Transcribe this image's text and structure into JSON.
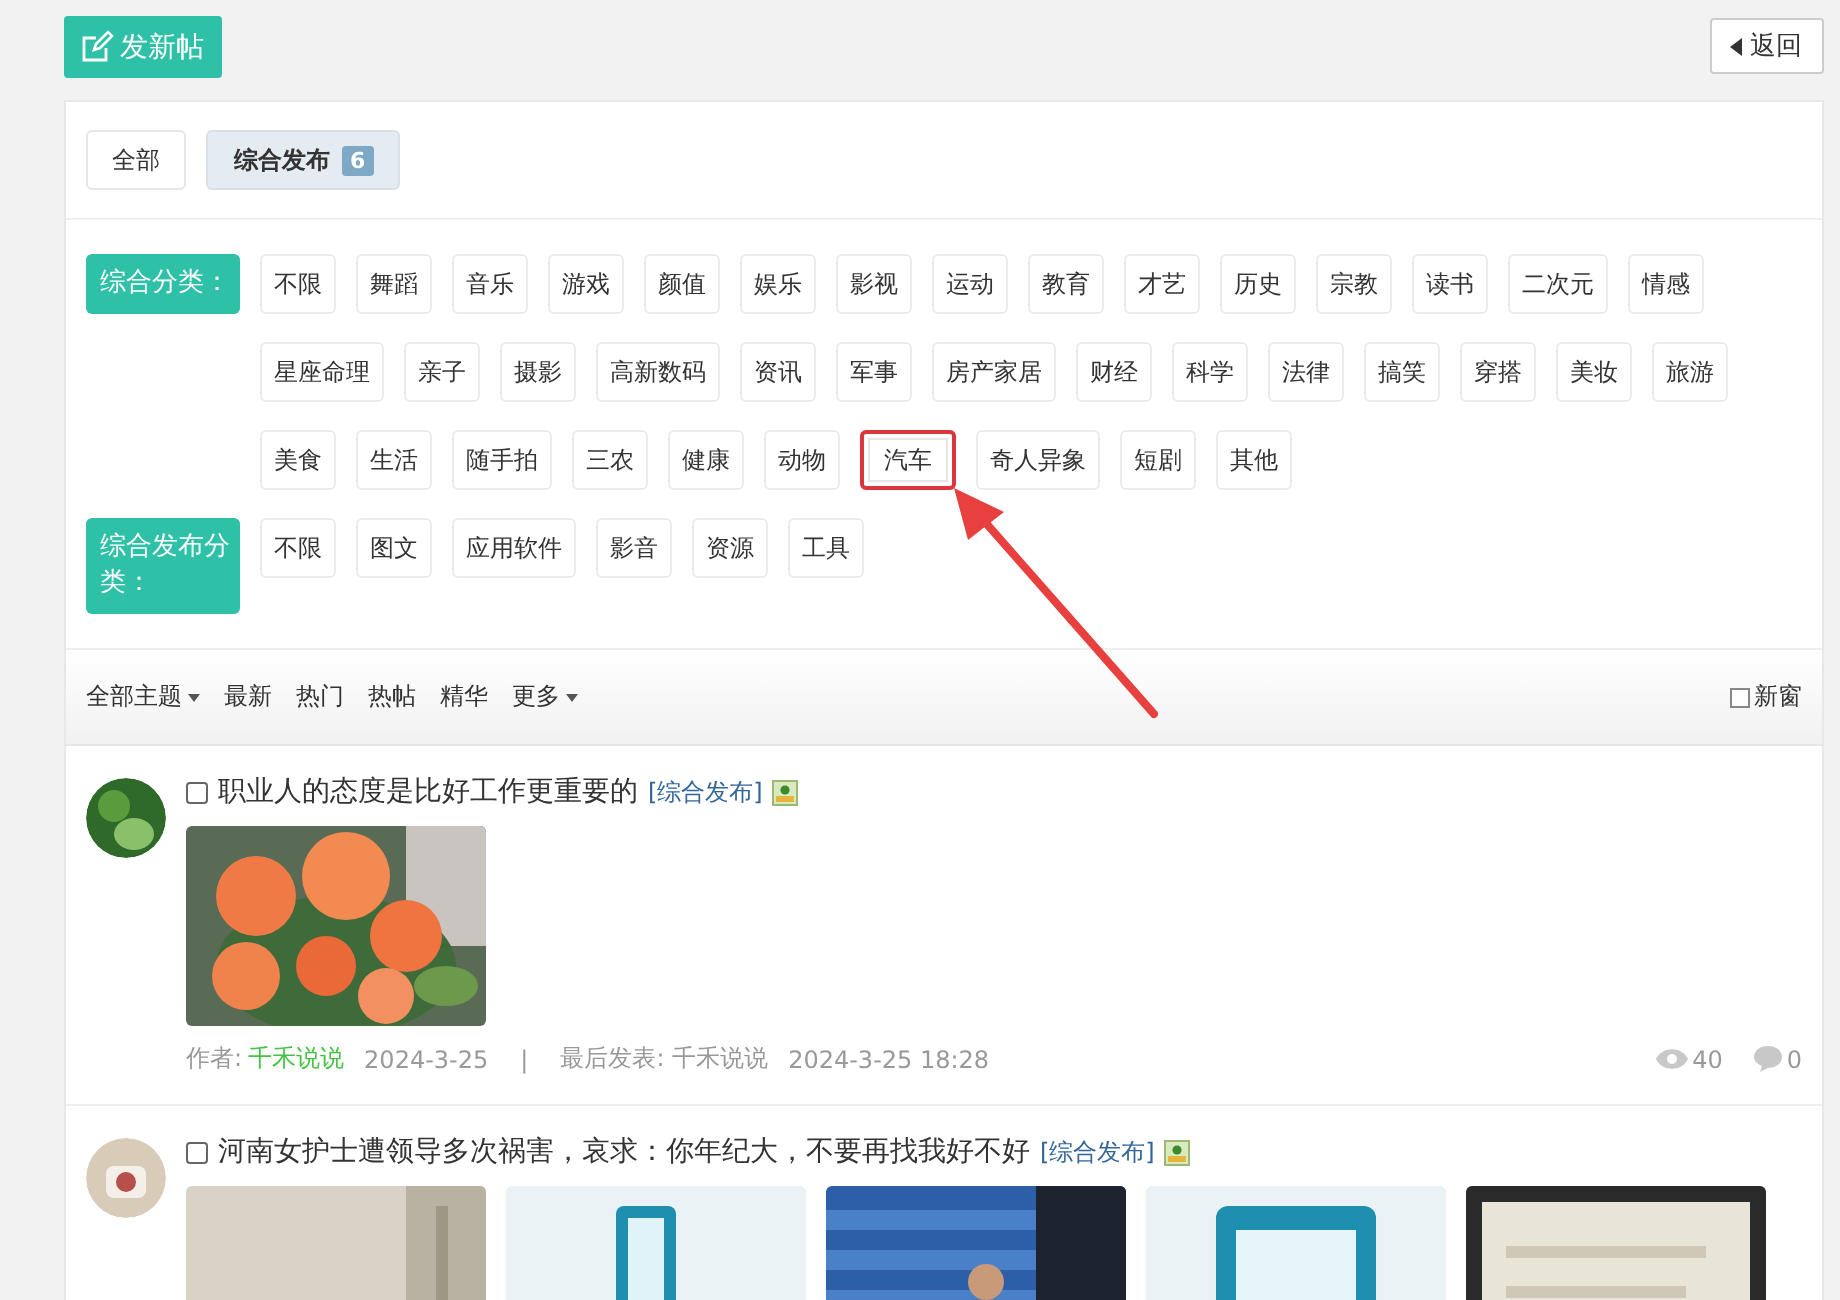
{
  "toolbar": {
    "new_post": "发新帖",
    "back": "返回"
  },
  "type_tabs": [
    {
      "label": "全部",
      "selected": false
    },
    {
      "label": "综合发布",
      "count": "6",
      "selected": true
    }
  ],
  "filters": [
    {
      "label": "综合分类：",
      "options": [
        {
          "label": "不限",
          "highlighted": false
        },
        {
          "label": "舞蹈",
          "highlighted": false
        },
        {
          "label": "音乐",
          "highlighted": false
        },
        {
          "label": "游戏",
          "highlighted": false
        },
        {
          "label": "颜值",
          "highlighted": false
        },
        {
          "label": "娱乐",
          "highlighted": false
        },
        {
          "label": "影视",
          "highlighted": false
        },
        {
          "label": "运动",
          "highlighted": false
        },
        {
          "label": "教育",
          "highlighted": false
        },
        {
          "label": "才艺",
          "highlighted": false
        },
        {
          "label": "历史",
          "highlighted": false
        },
        {
          "label": "宗教",
          "highlighted": false
        },
        {
          "label": "读书",
          "highlighted": false
        },
        {
          "label": "二次元",
          "highlighted": false
        },
        {
          "label": "情感",
          "highlighted": false
        },
        {
          "label": "星座命理",
          "highlighted": false
        },
        {
          "label": "亲子",
          "highlighted": false
        },
        {
          "label": "摄影",
          "highlighted": false
        },
        {
          "label": "高新数码",
          "highlighted": false
        },
        {
          "label": "资讯",
          "highlighted": false
        },
        {
          "label": "军事",
          "highlighted": false
        },
        {
          "label": "房产家居",
          "highlighted": false
        },
        {
          "label": "财经",
          "highlighted": false
        },
        {
          "label": "科学",
          "highlighted": false
        },
        {
          "label": "法律",
          "highlighted": false
        },
        {
          "label": "搞笑",
          "highlighted": false
        },
        {
          "label": "穿搭",
          "highlighted": false
        },
        {
          "label": "美妆",
          "highlighted": false
        },
        {
          "label": "旅游",
          "highlighted": false
        },
        {
          "label": "美食",
          "highlighted": false
        },
        {
          "label": "生活",
          "highlighted": false
        },
        {
          "label": "随手拍",
          "highlighted": false
        },
        {
          "label": "三农",
          "highlighted": false
        },
        {
          "label": "健康",
          "highlighted": false
        },
        {
          "label": "动物",
          "highlighted": false
        },
        {
          "label": "汽车",
          "highlighted": true
        },
        {
          "label": "奇人异象",
          "highlighted": false
        },
        {
          "label": "短剧",
          "highlighted": false
        },
        {
          "label": "其他",
          "highlighted": false
        }
      ]
    },
    {
      "label": "综合发布分类：",
      "options": [
        {
          "label": "不限",
          "highlighted": false
        },
        {
          "label": "图文",
          "highlighted": false
        },
        {
          "label": "应用软件",
          "highlighted": false
        },
        {
          "label": "影音",
          "highlighted": false
        },
        {
          "label": "资源",
          "highlighted": false
        },
        {
          "label": "工具",
          "highlighted": false
        }
      ]
    }
  ],
  "sort_bar": {
    "items": [
      {
        "label": "全部主题",
        "dropdown": true
      },
      {
        "label": "最新",
        "dropdown": false
      },
      {
        "label": "热门",
        "dropdown": false
      },
      {
        "label": "热帖",
        "dropdown": false
      },
      {
        "label": "精华",
        "dropdown": false
      },
      {
        "label": "更多",
        "dropdown": true
      }
    ],
    "new_window": {
      "label": "新窗",
      "checked": false
    }
  },
  "posts": [
    {
      "title": "职业人的态度是比好工作更重要的",
      "category": "[综合发布]",
      "checked": false,
      "meta": {
        "author_label": "作者:",
        "author": "千禾说说",
        "date": "2024-3-25",
        "separator": "|",
        "last_post": "最后发表: 千禾说说",
        "last_date": "2024-3-25 18:28",
        "views": "40",
        "replies": "0"
      }
    },
    {
      "title": "河南女护士遭领导多次祸害，哀求：你年纪大，不要再找我好不好",
      "category": "[综合发布]",
      "checked": false
    }
  ]
}
